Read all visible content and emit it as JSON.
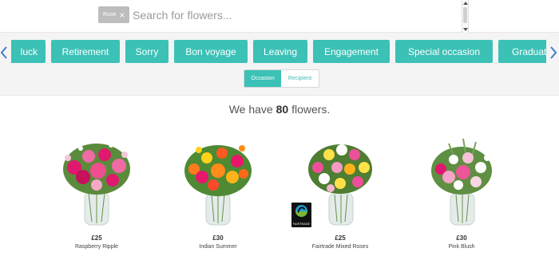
{
  "search": {
    "tag_label": "Rose",
    "remove_tag_glyph": "×",
    "placeholder": "Search for flowers..."
  },
  "categories": {
    "chips": [
      "luck",
      "Retirement",
      "Sorry",
      "Bon voyage",
      "Leaving",
      "Engagement",
      "Special occasion",
      "Graduation"
    ],
    "prev_icon": "chevron-left-icon",
    "next_icon": "chevron-right-icon"
  },
  "filter_toggle": {
    "options": [
      "Occasion",
      "Recipient"
    ],
    "selected": "Occasion"
  },
  "results": {
    "prefix": "We have",
    "count": "80",
    "suffix": "flowers."
  },
  "products": [
    {
      "price": "£25",
      "name": "Raspberry Ripple"
    },
    {
      "price": "£30",
      "name": "Indian Summer"
    },
    {
      "price": "£25",
      "name": "Fairtrade Mixed Roses",
      "badge": "FAIRTRADE"
    },
    {
      "price": "£30",
      "name": "Pink Blush"
    }
  ],
  "colors": {
    "accent": "#3cc1b6",
    "arrow": "#3f7fc8",
    "band": "#f4f4f4"
  }
}
